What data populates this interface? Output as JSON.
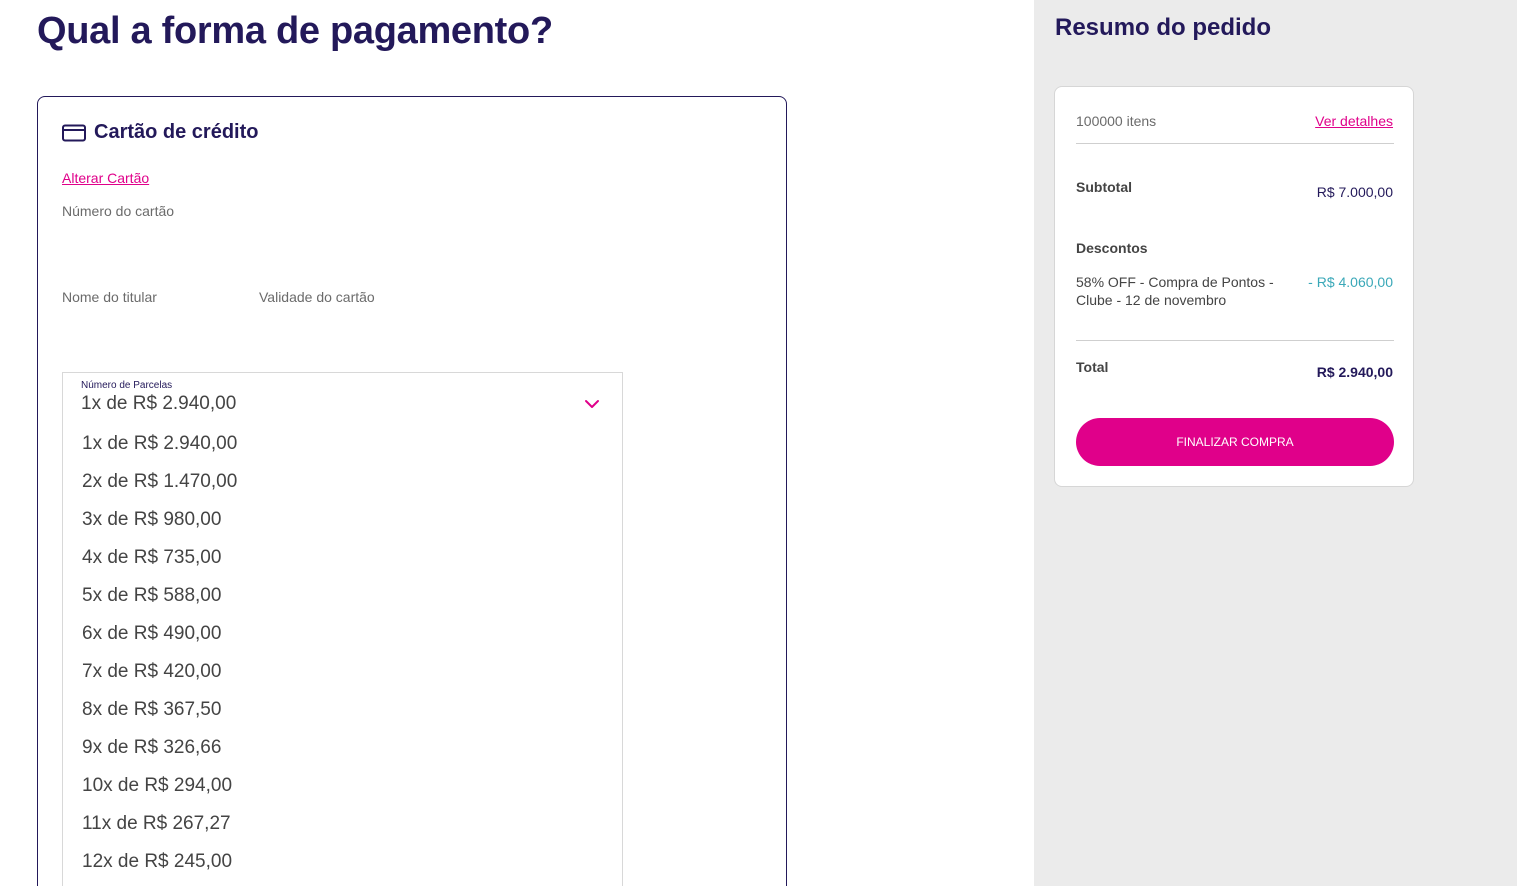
{
  "page": {
    "title": "Qual a forma de pagamento?"
  },
  "payment": {
    "card_title": "Cartão de crédito",
    "card_icon": "credit-card-icon",
    "change_card_link": "Alterar Cartão",
    "card_number_label": "Número do cartão",
    "holder_name_label": "Nome do titular",
    "validity_label": "Validade do cartão",
    "installments": {
      "label": "Número de Parcelas",
      "selected": "1x de R$ 2.940,00",
      "chevron_icon": "chevron-down-icon",
      "options": [
        "1x de R$ 2.940,00",
        "2x de R$ 1.470,00",
        "3x de R$ 980,00",
        "4x de R$ 735,00",
        "5x de R$ 588,00",
        "6x de R$ 490,00",
        "7x de R$ 420,00",
        "8x de R$ 367,50",
        "9x de R$ 326,66",
        "10x de R$ 294,00",
        "11x de R$ 267,27",
        "12x de R$ 245,00"
      ]
    }
  },
  "summary": {
    "title": "Resumo do pedido",
    "items_count": "100000 itens",
    "details_link": "Ver detalhes",
    "subtotal_label": "Subtotal",
    "subtotal_value": "R$ 7.000,00",
    "discounts_label": "Descontos",
    "discount_description": "58% OFF - Compra de Pontos - Clube - 12 de novembro",
    "discount_value": "- R$ 4.060,00",
    "total_label": "Total",
    "total_value": "R$ 2.940,00",
    "checkout_button": "FINALIZAR COMPRA"
  },
  "colors": {
    "brand_navy": "#23195a",
    "accent_pink": "#e0008a",
    "discount_teal": "#3aa8b8",
    "sidebar_bg": "#ebebeb"
  }
}
